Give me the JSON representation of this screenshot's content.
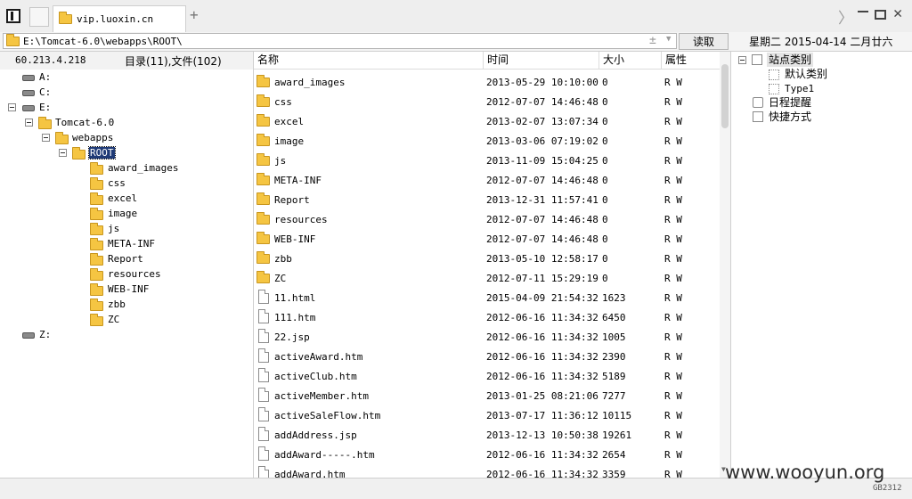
{
  "tab": {
    "title": "vip.luoxin.cn",
    "new_tab": "+"
  },
  "window": {
    "forward": "〉",
    "close": "✕"
  },
  "address": {
    "path": "E:\\Tomcat-6.0\\webapps\\ROOT\\",
    "plus": "±",
    "dropdown": "▼",
    "read_button": "读取"
  },
  "date_display": "星期二 2015-04-14 二月廿六",
  "left_panel": {
    "ip": "60.213.4.218",
    "counts": "目录(11),文件(102)",
    "tree": {
      "drive_a": "A:",
      "drive_c": "C:",
      "drive_e": "E:",
      "tomcat": "Tomcat-6.0",
      "webapps": "webapps",
      "root": "ROOT",
      "children": [
        "award_images",
        "css",
        "excel",
        "image",
        "js",
        "META-INF",
        "Report",
        "resources",
        "WEB-INF",
        "zbb",
        "ZC"
      ],
      "drive_z": "Z:"
    }
  },
  "file_list": {
    "headers": {
      "name": "名称",
      "time": "时间",
      "size": "大小",
      "attr": "属性"
    },
    "rows": [
      {
        "name": "award_images",
        "time": "2013-05-29 10:10:00",
        "size": "0",
        "attr": "R W",
        "type": "folder"
      },
      {
        "name": "css",
        "time": "2012-07-07 14:46:48",
        "size": "0",
        "attr": "R W",
        "type": "folder"
      },
      {
        "name": "excel",
        "time": "2013-02-07 13:07:34",
        "size": "0",
        "attr": "R W",
        "type": "folder"
      },
      {
        "name": "image",
        "time": "2013-03-06 07:19:02",
        "size": "0",
        "attr": "R W",
        "type": "folder"
      },
      {
        "name": "js",
        "time": "2013-11-09 15:04:25",
        "size": "0",
        "attr": "R W",
        "type": "folder"
      },
      {
        "name": "META-INF",
        "time": "2012-07-07 14:46:48",
        "size": "0",
        "attr": "R W",
        "type": "folder"
      },
      {
        "name": "Report",
        "time": "2013-12-31 11:57:41",
        "size": "0",
        "attr": "R W",
        "type": "folder"
      },
      {
        "name": "resources",
        "time": "2012-07-07 14:46:48",
        "size": "0",
        "attr": "R W",
        "type": "folder"
      },
      {
        "name": "WEB-INF",
        "time": "2012-07-07 14:46:48",
        "size": "0",
        "attr": "R W",
        "type": "folder"
      },
      {
        "name": "zbb",
        "time": "2013-05-10 12:58:17",
        "size": "0",
        "attr": "R W",
        "type": "folder"
      },
      {
        "name": "ZC",
        "time": "2012-07-11 15:29:19",
        "size": "0",
        "attr": "R W",
        "type": "folder"
      },
      {
        "name": "11.html",
        "time": "2015-04-09 21:54:32",
        "size": "1623",
        "attr": "R W",
        "type": "file"
      },
      {
        "name": "111.htm",
        "time": "2012-06-16 11:34:32",
        "size": "6450",
        "attr": "R W",
        "type": "file"
      },
      {
        "name": "22.jsp",
        "time": "2012-06-16 11:34:32",
        "size": "1005",
        "attr": "R W",
        "type": "file"
      },
      {
        "name": "activeAward.htm",
        "time": "2012-06-16 11:34:32",
        "size": "2390",
        "attr": "R W",
        "type": "file"
      },
      {
        "name": "activeClub.htm",
        "time": "2012-06-16 11:34:32",
        "size": "5189",
        "attr": "R W",
        "type": "file"
      },
      {
        "name": "activeMember.htm",
        "time": "2013-01-25 08:21:06",
        "size": "7277",
        "attr": "R W",
        "type": "file"
      },
      {
        "name": "activeSaleFlow.htm",
        "time": "2013-07-17 11:36:12",
        "size": "10115",
        "attr": "R W",
        "type": "file"
      },
      {
        "name": "addAddress.jsp",
        "time": "2013-12-13 10:50:38",
        "size": "19261",
        "attr": "R W",
        "type": "file"
      },
      {
        "name": "addAward-----.htm",
        "time": "2012-06-16 11:34:32",
        "size": "2654",
        "attr": "R W",
        "type": "file"
      },
      {
        "name": "addAward.htm",
        "time": "2012-06-16 11:34:32",
        "size": "3359",
        "attr": "R W",
        "type": "file"
      }
    ]
  },
  "right_panel": {
    "site_category": "站点类别",
    "default_category": "默认类别",
    "type1": "Type1",
    "schedule": "日程提醒",
    "shortcuts": "快捷方式"
  },
  "watermark": "www.wooyun.org",
  "build_tag": "GB2312"
}
